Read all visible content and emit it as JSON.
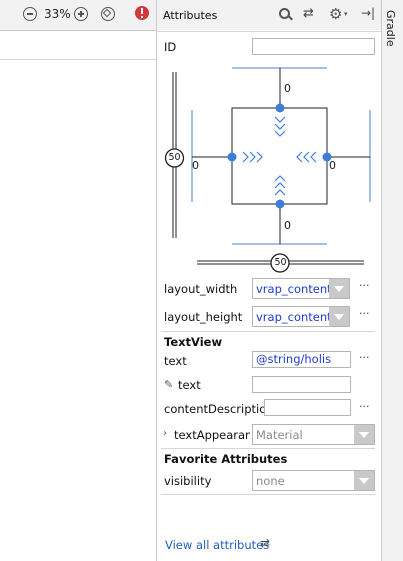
{
  "toolbar": {
    "zoom_out_icon": "minus-circle-icon",
    "zoom": "33%",
    "zoom_in_icon": "plus-circle-icon",
    "zoom_fit_icon": "zoom-fit-icon",
    "error_icon": "error-icon"
  },
  "attributes_panel": {
    "title": "Attributes",
    "icons": [
      "search-icon",
      "swap-icon",
      "gear-icon",
      "collapse-icon"
    ],
    "id_label": "ID",
    "id_value": "",
    "constraint_widget": {
      "top_margin": "0",
      "bottom_margin": "0",
      "left_margin": "0",
      "right_margin": "0",
      "vertical_bias": "50",
      "horizontal_bias": "50",
      "accent_color": "#3d7ed8"
    },
    "layout_width_label": "layout_width",
    "layout_width_value": "vrap_content",
    "layout_height_label": "layout_height",
    "layout_height_value": "vrap_content",
    "more_label": "···",
    "textview_section": "TextView",
    "text_label": "text",
    "text_value": "@string/holis",
    "tools_text_label": "text",
    "tools_text_value": "",
    "content_description_label": "contentDescription",
    "content_description_value": "",
    "text_appearance_label": "textAppearanc",
    "text_appearance_value": "Material",
    "favorites_section": "Favorite Attributes",
    "visibility_label": "visibility",
    "visibility_value": "none",
    "view_all_label": "View all attributes"
  },
  "side_tab": {
    "label": "Gradle"
  }
}
